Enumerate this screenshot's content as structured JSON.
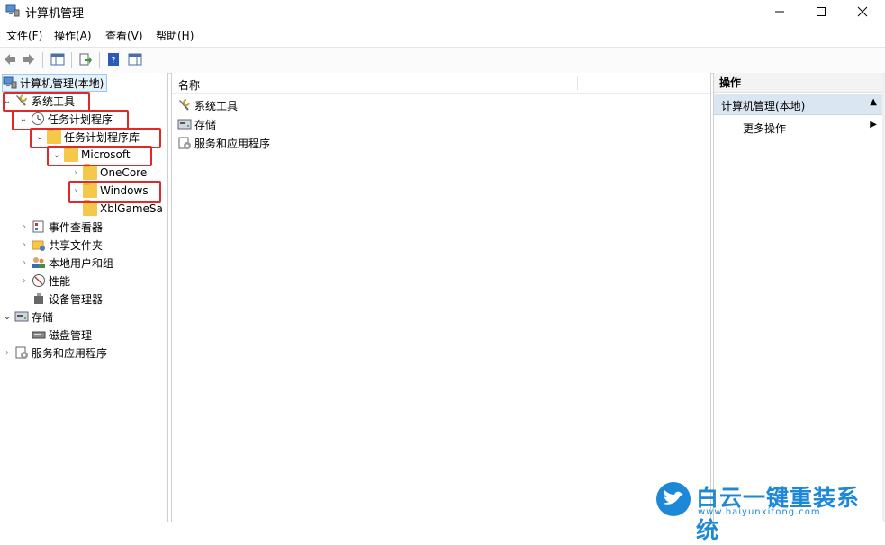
{
  "window": {
    "title": "计算机管理"
  },
  "menu": [
    "文件(F)",
    "操作(A)",
    "查看(V)",
    "帮助(H)"
  ],
  "tree": {
    "root": "计算机管理(本地)",
    "items": [
      {
        "label": "系统工具",
        "chevron": "down"
      },
      {
        "label": "任务计划程序",
        "chevron": "down"
      },
      {
        "label": "任务计划程序库",
        "chevron": "down"
      },
      {
        "label": "Microsoft",
        "chevron": "down"
      },
      {
        "label": "OneCore",
        "chevron": "right"
      },
      {
        "label": "Windows",
        "chevron": "right"
      },
      {
        "label": "XblGameSa",
        "chevron": ""
      },
      {
        "label": "事件查看器",
        "chevron": "right"
      },
      {
        "label": "共享文件夹",
        "chevron": "right"
      },
      {
        "label": "本地用户和组",
        "chevron": "right"
      },
      {
        "label": "性能",
        "chevron": "right"
      },
      {
        "label": "设备管理器",
        "chevron": ""
      },
      {
        "label": "存储",
        "chevron": "down"
      },
      {
        "label": "磁盘管理",
        "chevron": ""
      },
      {
        "label": "服务和应用程序",
        "chevron": "right"
      }
    ]
  },
  "center": {
    "column_name": "名称",
    "rows": [
      "系统工具",
      "存储",
      "服务和应用程序"
    ]
  },
  "actions": {
    "title": "操作",
    "section": "计算机管理(本地)",
    "items": [
      "更多操作"
    ]
  },
  "watermark": {
    "text": "白云一键重装系统",
    "url": "www.baiyunxitong.com"
  },
  "colors": {
    "highlight": "#e02a2a",
    "section_bg": "#dbe6f3",
    "watermark": "#1e88d8"
  }
}
